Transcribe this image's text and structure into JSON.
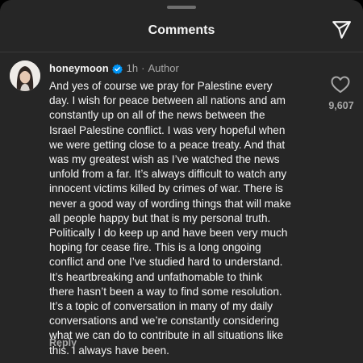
{
  "header": {
    "title": "Comments"
  },
  "comment": {
    "username": "honeymoon",
    "time": "1h",
    "separator": "·",
    "role": "Author",
    "lines": [
      "And yes of course we pray for Palestine every",
      "day. I wish for peace between all nations and am",
      "constantly up on all of the news between the",
      "Israel Palestine conflict. I was very hopeful when",
      "we were getting close to a peace treaty. And that",
      "was my greatest wish as I’ve watched the news",
      "unfold from a far. It’s always difficult to watch any",
      "innocent victims killed by crimes of war. There is",
      "never a good way of wording things that will make",
      "all people happy but that is my personal truth.",
      "Politically I do keep up and have been very much",
      "hoping for cease fire.  This is a long ongoing",
      "conflict and one I’ve studied hard to understand.",
      "It’s heartbreaking and unfathomable to think",
      "there hasn’t been a way to find some resolution.",
      "It’s a topic of conversation in many of my daily",
      "conversations and we’re constantly considering",
      "what we can do to contribute in all situations like",
      "this. I always have been."
    ],
    "reply_label": "Reply",
    "like_count": "9,607"
  },
  "icons": {
    "share": "paper-plane-icon",
    "verified": "verified-badge-icon",
    "like": "heart-outline-icon"
  },
  "colors": {
    "background": "#262626",
    "text": "#f5f5f5",
    "muted": "#a8a8a8",
    "verified": "#0095f6"
  }
}
